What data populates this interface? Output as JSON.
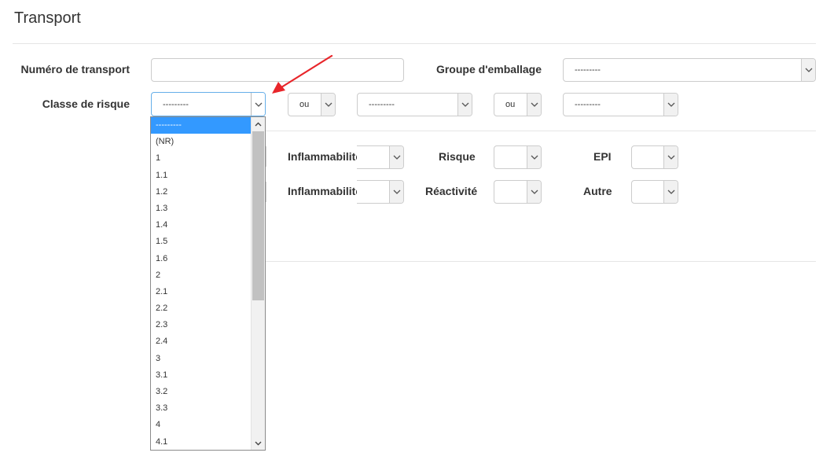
{
  "section": {
    "title": "Transport"
  },
  "labels": {
    "numero_transport": "Numéro de transport",
    "groupe_emballage": "Groupe d'emballage",
    "classe_risque": "Classe de risque",
    "inflammabilite_1": "Inflammabilité",
    "risque": "Risque",
    "epi": "EPI",
    "inflammabilite_2": "Inflammabilité",
    "reactivite": "Réactivité",
    "autre": "Autre"
  },
  "fields": {
    "numero_transport_value": "",
    "groupe_emballage_value": "---------",
    "classe_risque_value": "---------",
    "or_operator_1": "ou",
    "classe_risque_2_value": "---------",
    "or_operator_2": "ou",
    "classe_risque_3_value": "---------"
  },
  "dropdown": {
    "options": [
      "---------",
      "(NR)",
      "1",
      "1.1",
      "1.2",
      "1.3",
      "1.4",
      "1.5",
      "1.6",
      "2",
      "2.1",
      "2.2",
      "2.3",
      "2.4",
      "3",
      "3.1",
      "3.2",
      "3.3",
      "4",
      "4.1"
    ],
    "selected_index": 0
  },
  "colors": {
    "selected_option_bg": "#3399ff",
    "annotation_arrow": "#e8252a",
    "focus_border": "#66afe9"
  },
  "icons": {
    "select_arrow": "chevron-down-icon",
    "scroll_up": "chevron-up-icon",
    "scroll_down": "chevron-down-icon",
    "annotation": "red-arrow"
  }
}
